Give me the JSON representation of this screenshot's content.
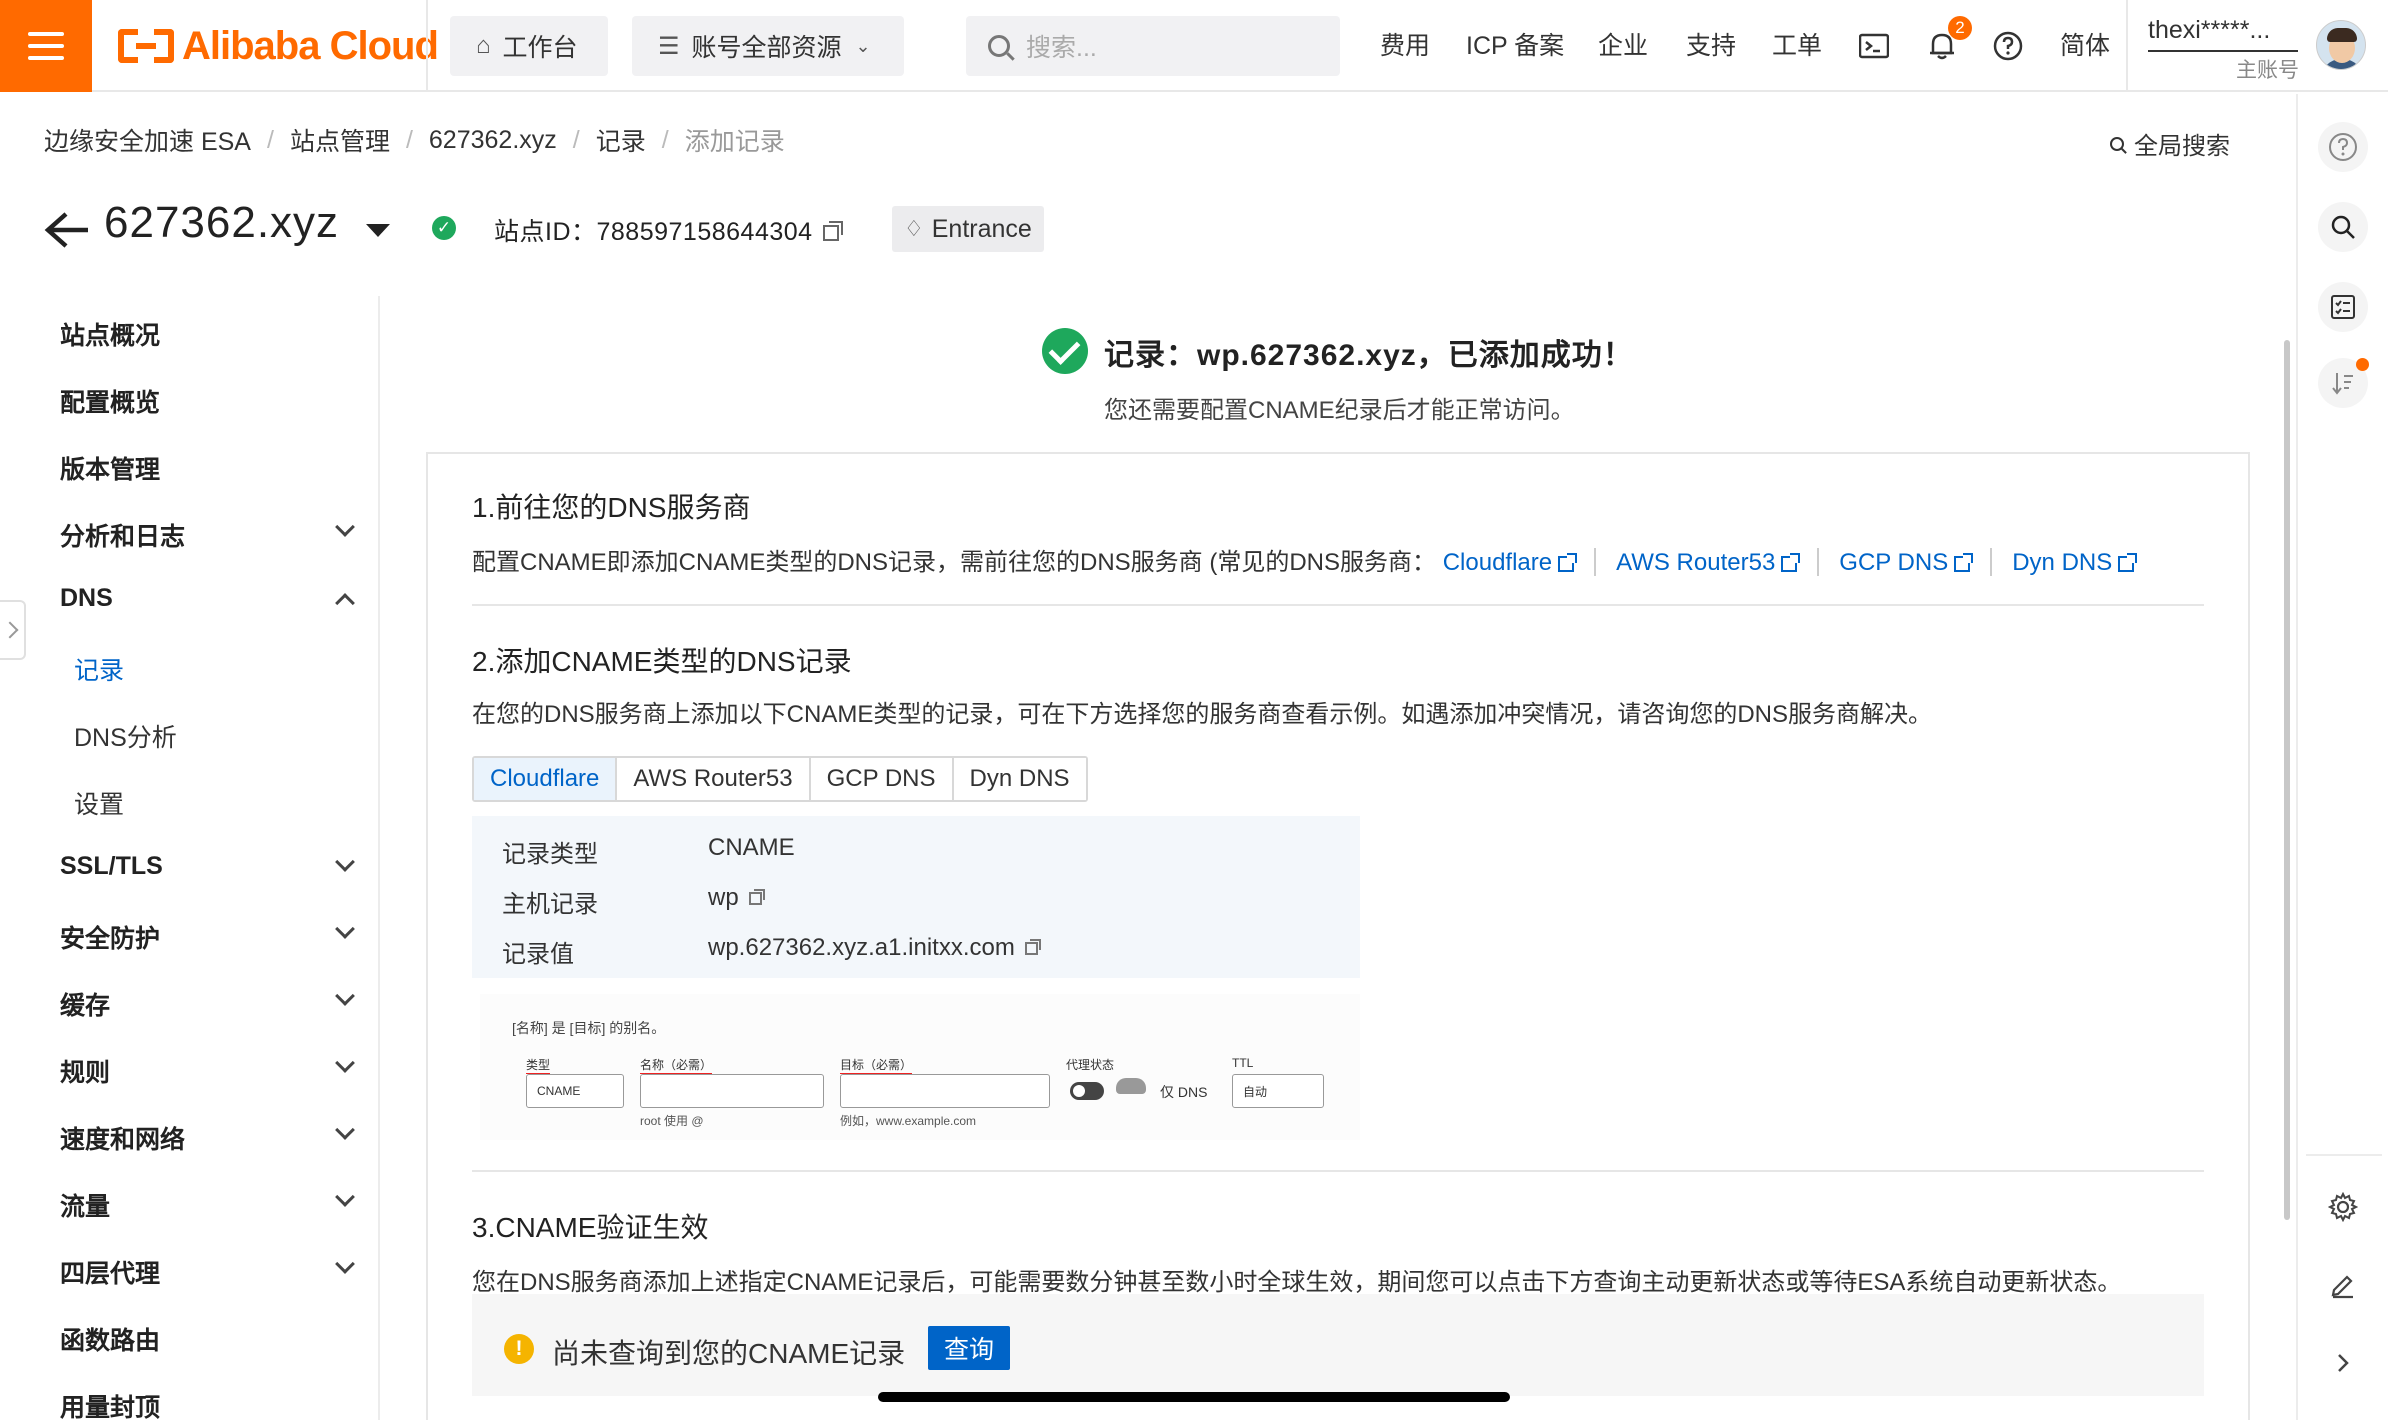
{
  "topbar": {
    "logo_text": "Alibaba Cloud",
    "workbench_label": "工作台",
    "resources_label": "账号全部资源",
    "search_placeholder": "搜索...",
    "links": [
      "费用",
      "ICP 备案",
      "企业",
      "支持",
      "工单"
    ],
    "notification_count": "2",
    "language_label": "简体",
    "account_name": "thexi*****...",
    "account_role": "主账号",
    "accent_color": "#ff6a00"
  },
  "breadcrumb": {
    "items": [
      "边缘安全加速 ESA",
      "站点管理",
      "627362.xyz",
      "记录",
      "添加记录"
    ],
    "global_search_label": "全局搜索"
  },
  "site": {
    "name": "627362.xyz",
    "id_label": "站点ID：788597158644304",
    "entrance_label": "Entrance"
  },
  "sidebar": {
    "items": [
      {
        "label": "站点概况"
      },
      {
        "label": "配置概览"
      },
      {
        "label": "版本管理"
      },
      {
        "label": "分析和日志"
      },
      {
        "label": "DNS"
      },
      {
        "label": "记录"
      },
      {
        "label": "DNS分析"
      },
      {
        "label": "设置"
      },
      {
        "label": "SSL/TLS"
      },
      {
        "label": "安全防护"
      },
      {
        "label": "缓存"
      },
      {
        "label": "规则"
      },
      {
        "label": "速度和网络"
      },
      {
        "label": "流量"
      },
      {
        "label": "四层代理"
      },
      {
        "label": "函数路由"
      },
      {
        "label": "用量封顶"
      }
    ],
    "active_color": "#0064c8"
  },
  "main": {
    "success_title": "记录：wp.627362.xyz，已添加成功！",
    "success_subtitle": "您还需要配置CNAME纪录后才能正常访问。",
    "step1": {
      "title": "1.前往您的DNS服务商",
      "desc": "配置CNAME即添加CNAME类型的DNS记录，需前往您的DNS服务商 (常见的DNS服务商：",
      "links": [
        "Cloudflare",
        "AWS Router53",
        "GCP DNS",
        "Dyn DNS"
      ]
    },
    "step2": {
      "title": "2.添加CNAME类型的DNS记录",
      "desc": "在您的DNS服务商上添加以下CNAME类型的记录，可在下方选择您的服务商查看示例。如遇添加冲突情况，请咨询您的DNS服务商解决。",
      "tabs": [
        "Cloudflare",
        "AWS Router53",
        "GCP DNS",
        "Dyn DNS"
      ],
      "active_tab": "Cloudflare",
      "record": {
        "type_label": "记录类型",
        "type_value": "CNAME",
        "host_label": "主机记录",
        "host_value": "wp",
        "value_label": "记录值",
        "value_value": "wp.627362.xyz.a1.initxx.com"
      },
      "example": {
        "note": "[名称] 是 [目标] 的别名。",
        "type_label": "类型",
        "type_value": "CNAME",
        "name_label": "名称（必需）",
        "name_hint": "root 使用 @",
        "target_label": "目标（必需）",
        "target_hint": "例如，www.example.com",
        "proxy_label": "代理状态",
        "proxy_value": "仅 DNS",
        "ttl_label": "TTL",
        "ttl_value": "自动"
      }
    },
    "step3": {
      "title": "3.CNAME验证生效",
      "desc": "您在DNS服务商添加上述指定CNAME记录后，可能需要数分钟甚至数小时全球生效，期间您可以点击下方查询主动更新状态或等待ESA系统自动更新状态。",
      "alert_text": "尚未查询到您的CNAME记录",
      "query_button": "查询"
    }
  },
  "right_rail": {
    "icons": [
      "help-icon",
      "search-icon",
      "checklist-icon",
      "sort-icon",
      "settings-icon",
      "edit-icon",
      "expand-icon"
    ]
  }
}
